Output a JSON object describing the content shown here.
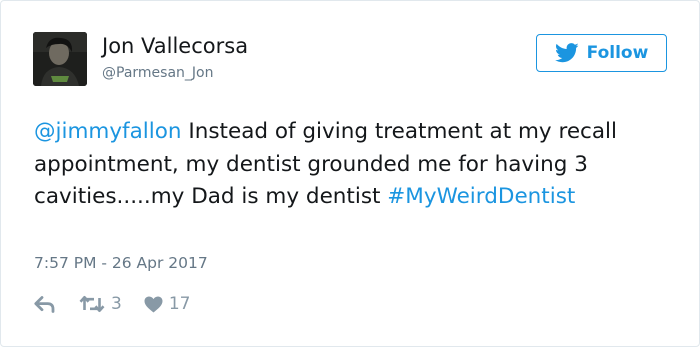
{
  "user": {
    "name": "Jon Vallecorsa",
    "handle": "@Parmesan_Jon",
    "avatar_icon": "profile-photo"
  },
  "follow_button": {
    "label": "Follow",
    "icon": "twitter-bird-icon",
    "color": "#1b95e0"
  },
  "tweet": {
    "mention": "@jimmyfallon",
    "body": " Instead of giving treatment at my recall appointment, my dentist grounded me for having 3 cavities.....my Dad is my dentist ",
    "hashtag": "#MyWeirdDentist",
    "timestamp": "7:57 PM - 26 Apr 2017"
  },
  "actions": {
    "reply_icon": "reply-icon",
    "retweet_icon": "retweet-icon",
    "retweet_count": "3",
    "like_icon": "heart-icon",
    "like_count": "17"
  },
  "colors": {
    "link": "#1b95e0",
    "secondary_text": "#657786",
    "action_icons": "#8899a6"
  }
}
